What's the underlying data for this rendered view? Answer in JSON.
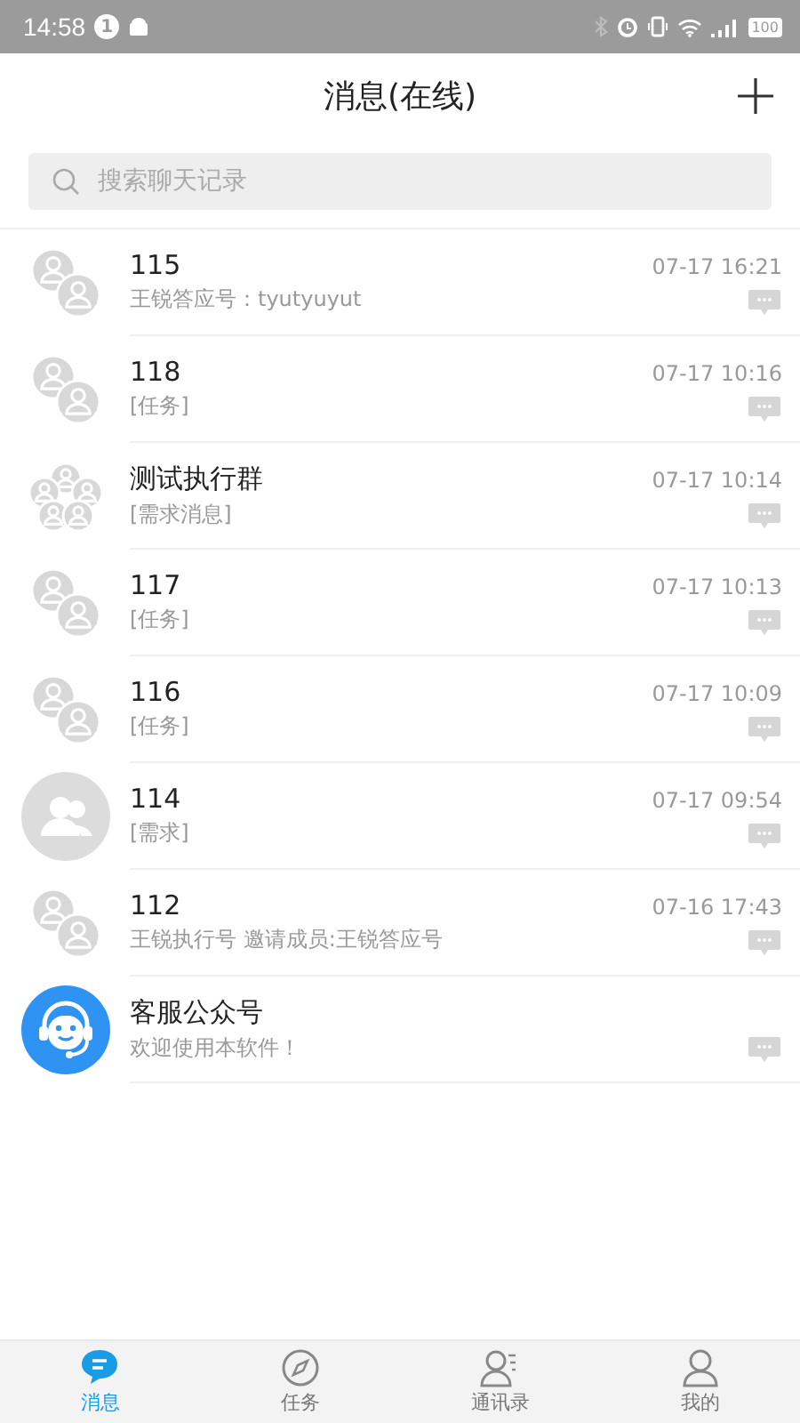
{
  "status_bar": {
    "time": "14:58",
    "notification_count": "1",
    "battery": "100"
  },
  "header": {
    "title": "消息(在线)"
  },
  "search": {
    "placeholder": "搜索聊天记录"
  },
  "conversations": [
    {
      "kind": "pair",
      "name": "115",
      "preview": "王锐答应号：tyutyuyut",
      "time": "07-17 16:21"
    },
    {
      "kind": "pair",
      "name": "118",
      "preview": "[任务]",
      "time": "07-17 10:16"
    },
    {
      "kind": "group",
      "name": "测试执行群",
      "preview": "[需求消息]",
      "time": "07-17 10:14"
    },
    {
      "kind": "pair",
      "name": "117",
      "preview": "[任务]",
      "time": "07-17 10:13"
    },
    {
      "kind": "pair",
      "name": "116",
      "preview": "[任务]",
      "time": "07-17 10:09"
    },
    {
      "kind": "single",
      "name": "114",
      "preview": "[需求]",
      "time": "07-17 09:54"
    },
    {
      "kind": "pair",
      "name": "112",
      "preview": "王锐执行号 邀请成员:王锐答应号",
      "time": "07-16 17:43"
    },
    {
      "kind": "service",
      "name": "客服公众号",
      "preview": "欢迎使用本软件！"
    }
  ],
  "tabs": [
    {
      "label": "消息",
      "selected": true
    },
    {
      "label": "任务",
      "selected": false
    },
    {
      "label": "通讯录",
      "selected": false
    },
    {
      "label": "我的",
      "selected": false
    }
  ]
}
